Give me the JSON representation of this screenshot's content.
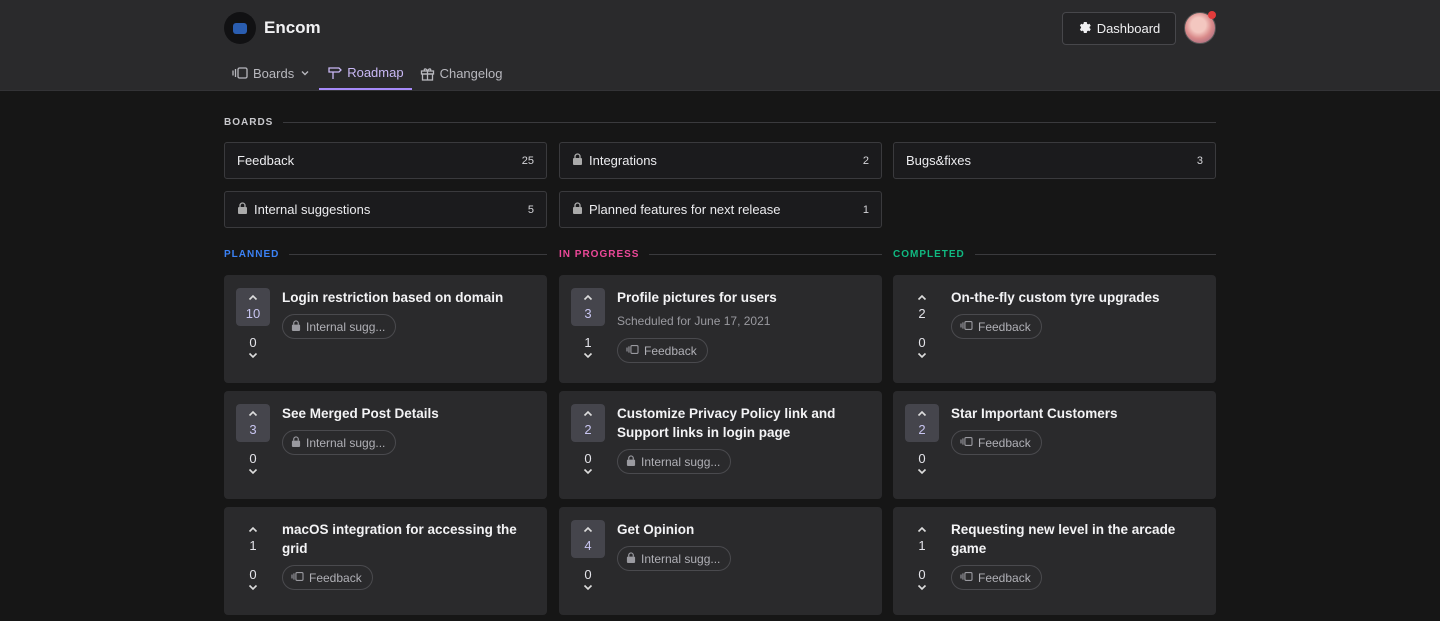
{
  "brand": {
    "name": "Encom"
  },
  "header": {
    "dashboard_label": "Dashboard"
  },
  "nav": [
    {
      "label": "Boards",
      "icon": "boards-icon",
      "has_dropdown": true
    },
    {
      "label": "Roadmap",
      "icon": "roadmap-icon",
      "active": true
    },
    {
      "label": "Changelog",
      "icon": "gift-icon"
    }
  ],
  "boards_section": {
    "title": "BOARDS",
    "items": [
      {
        "name": "Feedback",
        "count": "25",
        "locked": false
      },
      {
        "name": "Integrations",
        "count": "2",
        "locked": true
      },
      {
        "name": "Bugs&fixes",
        "count": "3",
        "locked": false
      },
      {
        "name": "Internal suggestions",
        "count": "5",
        "locked": true
      },
      {
        "name": "Planned features for next release",
        "count": "1",
        "locked": true
      }
    ]
  },
  "columns": [
    {
      "title": "PLANNED",
      "color": "#3b82f6",
      "cards": [
        {
          "upvotes": "10",
          "upvoted": true,
          "downvotes": "0",
          "title": "Login restriction based on domain",
          "tag": "Internal sugg...",
          "tag_icon": "lock-icon"
        },
        {
          "upvotes": "3",
          "upvoted": true,
          "downvotes": "0",
          "title": "See Merged Post Details",
          "tag": "Internal sugg...",
          "tag_icon": "lock-icon"
        },
        {
          "upvotes": "1",
          "upvoted": false,
          "downvotes": "0",
          "title": "macOS integration for accessing the grid",
          "tag": "Feedback",
          "tag_icon": "boards-icon"
        }
      ]
    },
    {
      "title": "IN PROGRESS",
      "color": "#ec4899",
      "cards": [
        {
          "upvotes": "3",
          "upvoted": true,
          "downvotes": "1",
          "title": "Profile pictures for users",
          "subtitle": "Scheduled for June 17, 2021",
          "tag": "Feedback",
          "tag_icon": "boards-icon"
        },
        {
          "upvotes": "2",
          "upvoted": true,
          "downvotes": "0",
          "title": "Customize Privacy Policy link and Support links in login page",
          "tag": "Internal sugg...",
          "tag_icon": "lock-icon"
        },
        {
          "upvotes": "4",
          "upvoted": true,
          "downvotes": "0",
          "title": "Get Opinion",
          "tag": "Internal sugg...",
          "tag_icon": "lock-icon"
        }
      ]
    },
    {
      "title": "COMPLETED",
      "color": "#10b981",
      "cards": [
        {
          "upvotes": "2",
          "upvoted": false,
          "downvotes": "0",
          "title": "On-the-fly custom tyre upgrades",
          "tag": "Feedback",
          "tag_icon": "boards-icon"
        },
        {
          "upvotes": "2",
          "upvoted": true,
          "downvotes": "0",
          "title": "Star Important Customers",
          "tag": "Feedback",
          "tag_icon": "boards-icon"
        },
        {
          "upvotes": "1",
          "upvoted": false,
          "downvotes": "0",
          "title": "Requesting new level in the arcade game",
          "tag": "Feedback",
          "tag_icon": "boards-icon"
        }
      ]
    }
  ]
}
